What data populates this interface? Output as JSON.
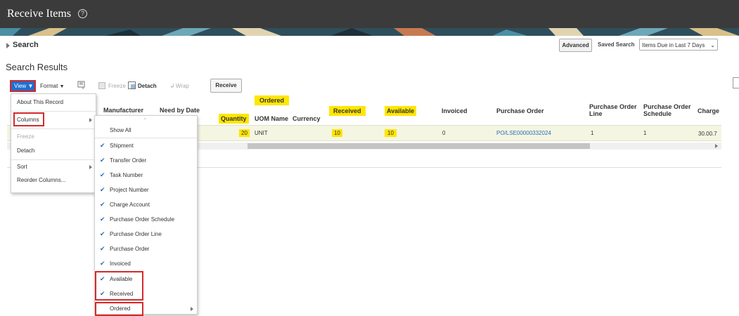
{
  "header": {
    "title": "Receive Items",
    "help_icon": "?"
  },
  "search": {
    "label": "Search",
    "advanced": "Advanced",
    "saved_search_label": "Saved Search",
    "saved_search_value": "Items Due in Last 7 Days"
  },
  "results": {
    "title": "Search Results"
  },
  "toolbar": {
    "view": "View",
    "format": "Format",
    "freeze": "Freeze",
    "detach": "Detach",
    "wrap": "Wrap",
    "receive": "Receive"
  },
  "table": {
    "headers": {
      "manufacturer": "Manufacturer",
      "need_by_date": "Need by Date",
      "ordered_group": "Ordered",
      "quantity": "Quantity",
      "uom": "UOM Name",
      "currency": "Currency",
      "received": "Received",
      "available": "Available",
      "invoiced": "Invoiced",
      "purchase_order": "Purchase Order",
      "po_line_1": "Purchase Order",
      "po_line_2": "Line",
      "po_schedule_1": "Purchase Order",
      "po_schedule_2": "Schedule",
      "charge": "Charge"
    },
    "row": {
      "quantity": "20",
      "uom": "UNIT",
      "received": "10",
      "available": "10",
      "invoiced": "0",
      "purchase_order": "PO/LSE00000332024",
      "po_line": "1",
      "po_schedule": "1",
      "charge": "30.00.7"
    }
  },
  "view_menu": {
    "items": [
      "About This Record",
      "Columns",
      "Freeze",
      "Detach",
      "Sort",
      "Reorder Columns..."
    ]
  },
  "columns_menu": {
    "show_all": "Show All",
    "items": [
      {
        "label": "Shipment",
        "checked": true
      },
      {
        "label": "Transfer Order",
        "checked": true
      },
      {
        "label": "Task Number",
        "checked": true
      },
      {
        "label": "Project Number",
        "checked": true
      },
      {
        "label": "Charge Account",
        "checked": true
      },
      {
        "label": "Purchase Order Schedule",
        "checked": true
      },
      {
        "label": "Purchase Order Line",
        "checked": true
      },
      {
        "label": "Purchase Order",
        "checked": true
      },
      {
        "label": "Invoiced",
        "checked": true
      },
      {
        "label": "Available",
        "checked": true
      },
      {
        "label": "Received",
        "checked": true
      },
      {
        "label": "Ordered",
        "checked": false
      }
    ]
  },
  "colors": {
    "titlebar": "#3b3b3b",
    "accent_blue": "#1f6fcf",
    "highlight": "#ffe600",
    "annotation_red": "#d42a2a",
    "link": "#2a6db5"
  }
}
